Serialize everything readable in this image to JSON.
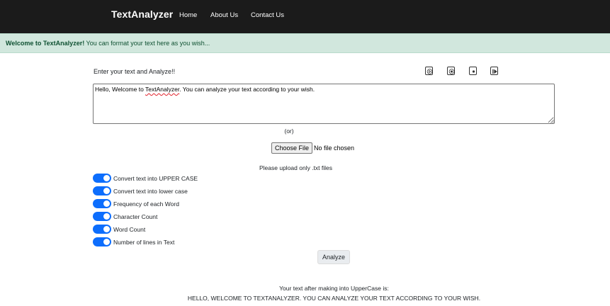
{
  "navbar": {
    "brand": "TextAnalyzer",
    "links": [
      "Home",
      "About Us",
      "Contact Us"
    ]
  },
  "alert": {
    "strong": "Welcome to TextAnalyzer!",
    "message": " You can format your text here as you wish..."
  },
  "main": {
    "prompt_label": "Enter your text and Analyze!!",
    "media_controls": [
      "play-icon",
      "stop-icon",
      "record-icon",
      "next-icon"
    ],
    "textarea": {
      "before": "Hello, Welcome to ",
      "misspelled": "TextAnalyzer",
      "after": ". You can analyze your text according to your wish."
    },
    "or_text": "(or)",
    "file_button": "Choose File",
    "file_status": "No file chosen",
    "upload_note": "Please upload only .txt files",
    "options": [
      {
        "label": "Convert text into UPPER CASE",
        "checked": true
      },
      {
        "label": "Convert text into lower case",
        "checked": true
      },
      {
        "label": "Frequency of each Word",
        "checked": true
      },
      {
        "label": "Character Count",
        "checked": true
      },
      {
        "label": "Word Count",
        "checked": true
      },
      {
        "label": "Number of lines in Text",
        "checked": true
      }
    ],
    "analyze_button": "Analyze",
    "result_title": "Your text after making into UpperCase is:",
    "result_text": "HELLO, WELCOME TO TEXTANALYZER. YOU CAN ANALYZE YOUR TEXT ACCORDING TO YOUR WISH."
  },
  "colors": {
    "navbar": "#1b1b1b",
    "alert_bg": "#d1e7dd",
    "alert_text": "#0f5132",
    "switch_on": "#0d6efd"
  }
}
